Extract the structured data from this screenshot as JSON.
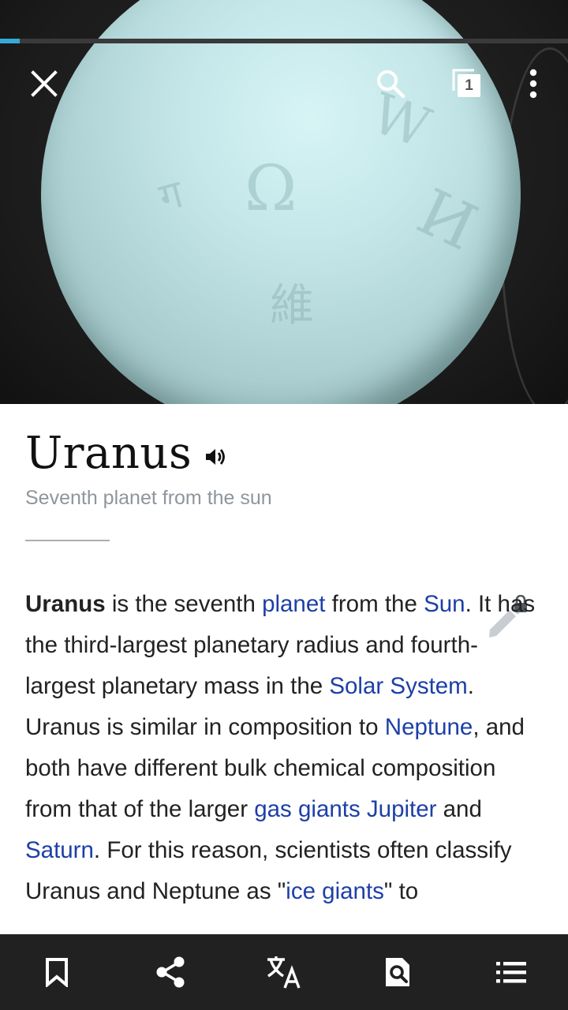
{
  "toolbar": {
    "load_progress": 0.035,
    "tab_count": "1",
    "close_icon": "close-icon",
    "search_icon": "search-icon",
    "tabs_icon": "tabs-icon",
    "overflow_icon": "more-vert-icon"
  },
  "hero": {
    "image": "uranus-planet-image"
  },
  "article": {
    "title": "Uranus",
    "description": "Seventh planet from the sun",
    "paragraph": [
      {
        "text": "Uranus",
        "type": "bold"
      },
      {
        "text": " is the seventh ",
        "type": "text"
      },
      {
        "text": "planet",
        "type": "link"
      },
      {
        "text": " from the ",
        "type": "text"
      },
      {
        "text": "Sun",
        "type": "link"
      },
      {
        "text": ". It has the third-largest planetary radius and fourth-largest planetary mass in the ",
        "type": "text"
      },
      {
        "text": "Solar System",
        "type": "link"
      },
      {
        "text": ". Uranus is similar in composition to ",
        "type": "text"
      },
      {
        "text": "Neptune",
        "type": "link"
      },
      {
        "text": ", and both have different bulk chemical composition from that of the larger ",
        "type": "text"
      },
      {
        "text": "gas giants",
        "type": "link"
      },
      {
        "text": " ",
        "type": "text"
      },
      {
        "text": "Jupiter",
        "type": "link"
      },
      {
        "text": " and ",
        "type": "text"
      },
      {
        "text": "Saturn",
        "type": "link"
      },
      {
        "text": ". For this reason, scientists often classify Uranus and Neptune as \"",
        "type": "text"
      },
      {
        "text": "ice giants",
        "type": "link"
      },
      {
        "text": "\" to",
        "type": "text"
      }
    ]
  },
  "bottom_bar": [
    {
      "name": "bookmark-icon"
    },
    {
      "name": "share-icon"
    },
    {
      "name": "translate-icon"
    },
    {
      "name": "find-in-page-icon"
    },
    {
      "name": "table-of-contents-icon"
    }
  ],
  "colors": {
    "link": "#1d3fa7",
    "progress": "#36a9d9",
    "bottom_bar": "#212121"
  }
}
